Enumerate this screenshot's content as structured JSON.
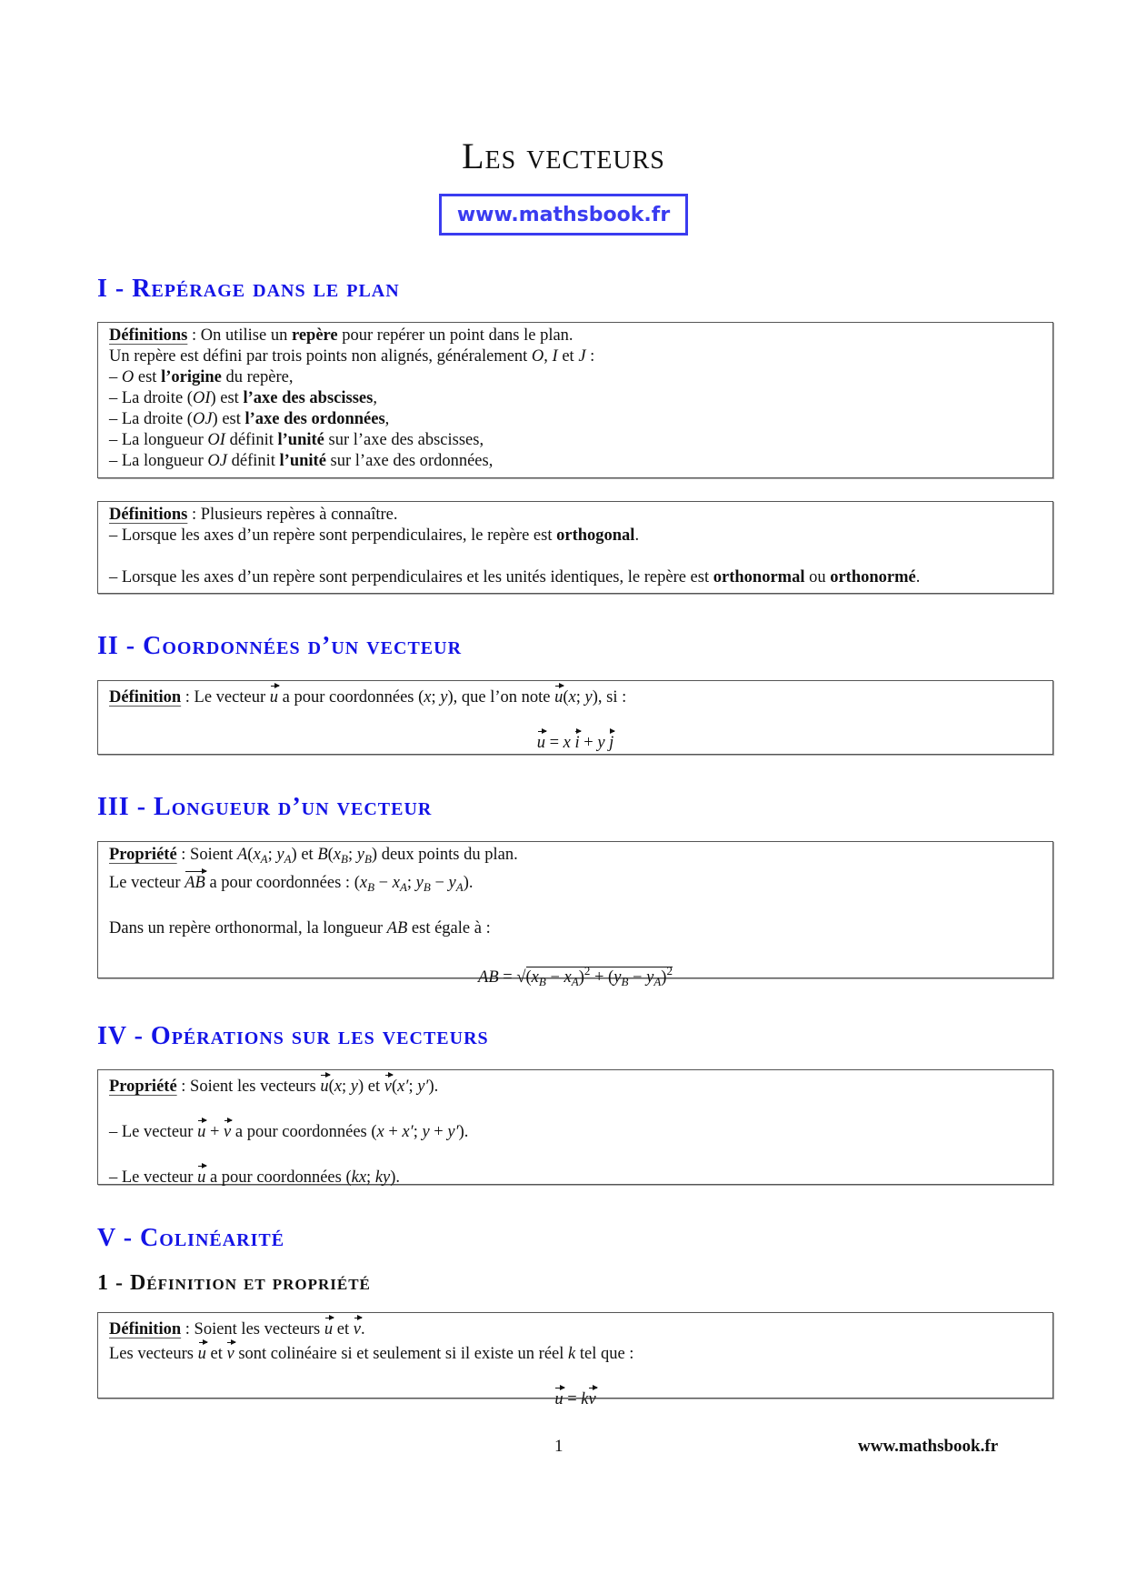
{
  "title": "Les vecteurs",
  "site_url": "www.mathsbook.fr",
  "colors": {
    "heading": "#1414e6",
    "url_box": "#3a3cf0",
    "text": "#111111"
  },
  "sections": [
    {
      "heading": "I - Repérage dans le plan",
      "boxes": [
        {
          "label": "Définitions",
          "lines": [
            [
              ": On utilise un ",
              {
                "b": "repère"
              },
              " pour repérer un point dans le plan."
            ],
            [
              "Un repère est défini par trois points non alignés, généralement ",
              {
                "m": "O"
              },
              ", ",
              {
                "m": "I"
              },
              " et ",
              {
                "m": "J"
              },
              " :"
            ],
            [
              "– ",
              {
                "m": "O"
              },
              " est ",
              {
                "b": "l’origine"
              },
              " du repère,"
            ],
            [
              "– La droite (",
              {
                "m": "OI"
              },
              ") est ",
              {
                "b": "l’axe des abscisses"
              },
              ","
            ],
            [
              "– La droite (",
              {
                "m": "OJ"
              },
              ") est ",
              {
                "b": "l’axe des ordonnées"
              },
              ","
            ],
            [
              "– La longueur ",
              {
                "m": "OI"
              },
              " définit ",
              {
                "b": "l’unité"
              },
              " sur l’axe des abscisses,"
            ],
            [
              "– La longueur ",
              {
                "m": "OJ"
              },
              " définit ",
              {
                "b": "l’unité"
              },
              " sur l’axe des ordonnées,"
            ]
          ]
        },
        {
          "label": "Définitions",
          "lines": [
            [
              ": Plusieurs repères à connaître."
            ],
            [
              "– Lorsque les axes d’un repère sont perpendiculaires, le repère est ",
              {
                "b": "orthogonal"
              },
              "."
            ],
            [],
            [
              "– Lorsque les axes d’un repère sont perpendiculaires et les unités identiques, le repère est ",
              {
                "b": "orthonormal"
              },
              " ou ",
              {
                "b": "orthonormé"
              },
              "."
            ]
          ]
        }
      ]
    },
    {
      "heading": "II - Coordonnées d’un vecteur",
      "boxes": [
        {
          "label": "Définition",
          "lines": [
            [
              ": Le vecteur ",
              {
                "v": "u"
              },
              " a pour coordonnées (",
              {
                "m": "x"
              },
              "; ",
              {
                "m": "y"
              },
              "), que l’on note ",
              {
                "v": "u"
              },
              "(",
              {
                "m": "x"
              },
              "; ",
              {
                "m": "y"
              },
              "), si :"
            ],
            [],
            {
              "center": [
                {
                  "v": "u"
                },
                " = ",
                {
                  "m": "x"
                },
                " ",
                {
                  "v": "i"
                },
                " + ",
                {
                  "m": "y"
                },
                " ",
                {
                  "v": "j"
                }
              ]
            }
          ]
        }
      ]
    },
    {
      "heading": "III - Longueur d’un vecteur",
      "boxes": [
        {
          "label": "Propriété",
          "lines": [
            [
              ": Soient ",
              {
                "m": "A"
              },
              "(",
              {
                "m": "x"
              },
              {
                "sub": "A"
              },
              "; ",
              {
                "m": "y"
              },
              {
                "sub": "A"
              },
              ") et ",
              {
                "m": "B"
              },
              "(",
              {
                "m": "x"
              },
              {
                "sub": "B"
              },
              "; ",
              {
                "m": "y"
              },
              {
                "sub": "B"
              },
              ") deux points du plan."
            ],
            [
              "Le vecteur ",
              {
                "v": "AB"
              },
              " a pour coordonnées : (",
              {
                "m": "x"
              },
              {
                "sub": "B"
              },
              " − ",
              {
                "m": "x"
              },
              {
                "sub": "A"
              },
              "; ",
              {
                "m": "y"
              },
              {
                "sub": "B"
              },
              " − ",
              {
                "m": "y"
              },
              {
                "sub": "A"
              },
              ")."
            ],
            [],
            [
              "Dans un repère orthonormal, la longueur ",
              {
                "m": "AB"
              },
              " est égale à :"
            ],
            [],
            {
              "center": [
                {
                  "m": "AB"
                },
                " = √",
                {
                  "sqrt": [
                    "(",
                    {
                      "m": "x"
                    },
                    {
                      "sub": "B"
                    },
                    " − ",
                    {
                      "m": "x"
                    },
                    {
                      "sub": "A"
                    },
                    ")",
                    {
                      "sup": "2"
                    },
                    " + (",
                    {
                      "m": "y"
                    },
                    {
                      "sub": "B"
                    },
                    " − ",
                    {
                      "m": "y"
                    },
                    {
                      "sub": "A"
                    },
                    ")",
                    {
                      "sup": "2"
                    }
                  ]
                }
              ]
            }
          ]
        }
      ]
    },
    {
      "heading": "IV - Opérations sur les vecteurs",
      "boxes": [
        {
          "label": "Propriété",
          "lines": [
            [
              ": Soient les vecteurs ",
              {
                "v": "u"
              },
              "(",
              {
                "m": "x"
              },
              "; ",
              {
                "m": "y"
              },
              ") et ",
              {
                "v": "v"
              },
              "(",
              {
                "m": "x′"
              },
              "; ",
              {
                "m": "y′"
              },
              ")."
            ],
            [],
            [
              "– Le vecteur ",
              {
                "v": "u"
              },
              " + ",
              {
                "v": "v"
              },
              " a pour coordonnées (",
              {
                "m": "x"
              },
              " + ",
              {
                "m": "x′"
              },
              "; ",
              {
                "m": "y"
              },
              " + ",
              {
                "m": "y′"
              },
              ")."
            ],
            [],
            [
              "– Le vecteur ",
              {
                "v": "u"
              },
              " a pour coordonnées (",
              {
                "m": "kx"
              },
              "; ",
              {
                "m": "ky"
              },
              ")."
            ]
          ]
        }
      ]
    },
    {
      "heading": "V - Colinéarité",
      "subheading": "1 - Définition et propriété",
      "boxes": [
        {
          "label": "Définition",
          "lines": [
            [
              ": Soient les vecteurs ",
              {
                "v": "u"
              },
              " et ",
              {
                "v": "v"
              },
              "."
            ],
            [
              "Les vecteurs ",
              {
                "v": "u"
              },
              " et ",
              {
                "v": "v"
              },
              " sont colinéaire si et seulement si il existe un réel ",
              {
                "m": "k"
              },
              " tel que :"
            ],
            [],
            {
              "center": [
                {
                  "v": "u"
                },
                " = ",
                {
                  "m": "k"
                },
                {
                  "v": "v"
                }
              ]
            }
          ]
        }
      ]
    }
  ],
  "footer": {
    "page_number": "1",
    "url": "www.mathsbook.fr"
  }
}
